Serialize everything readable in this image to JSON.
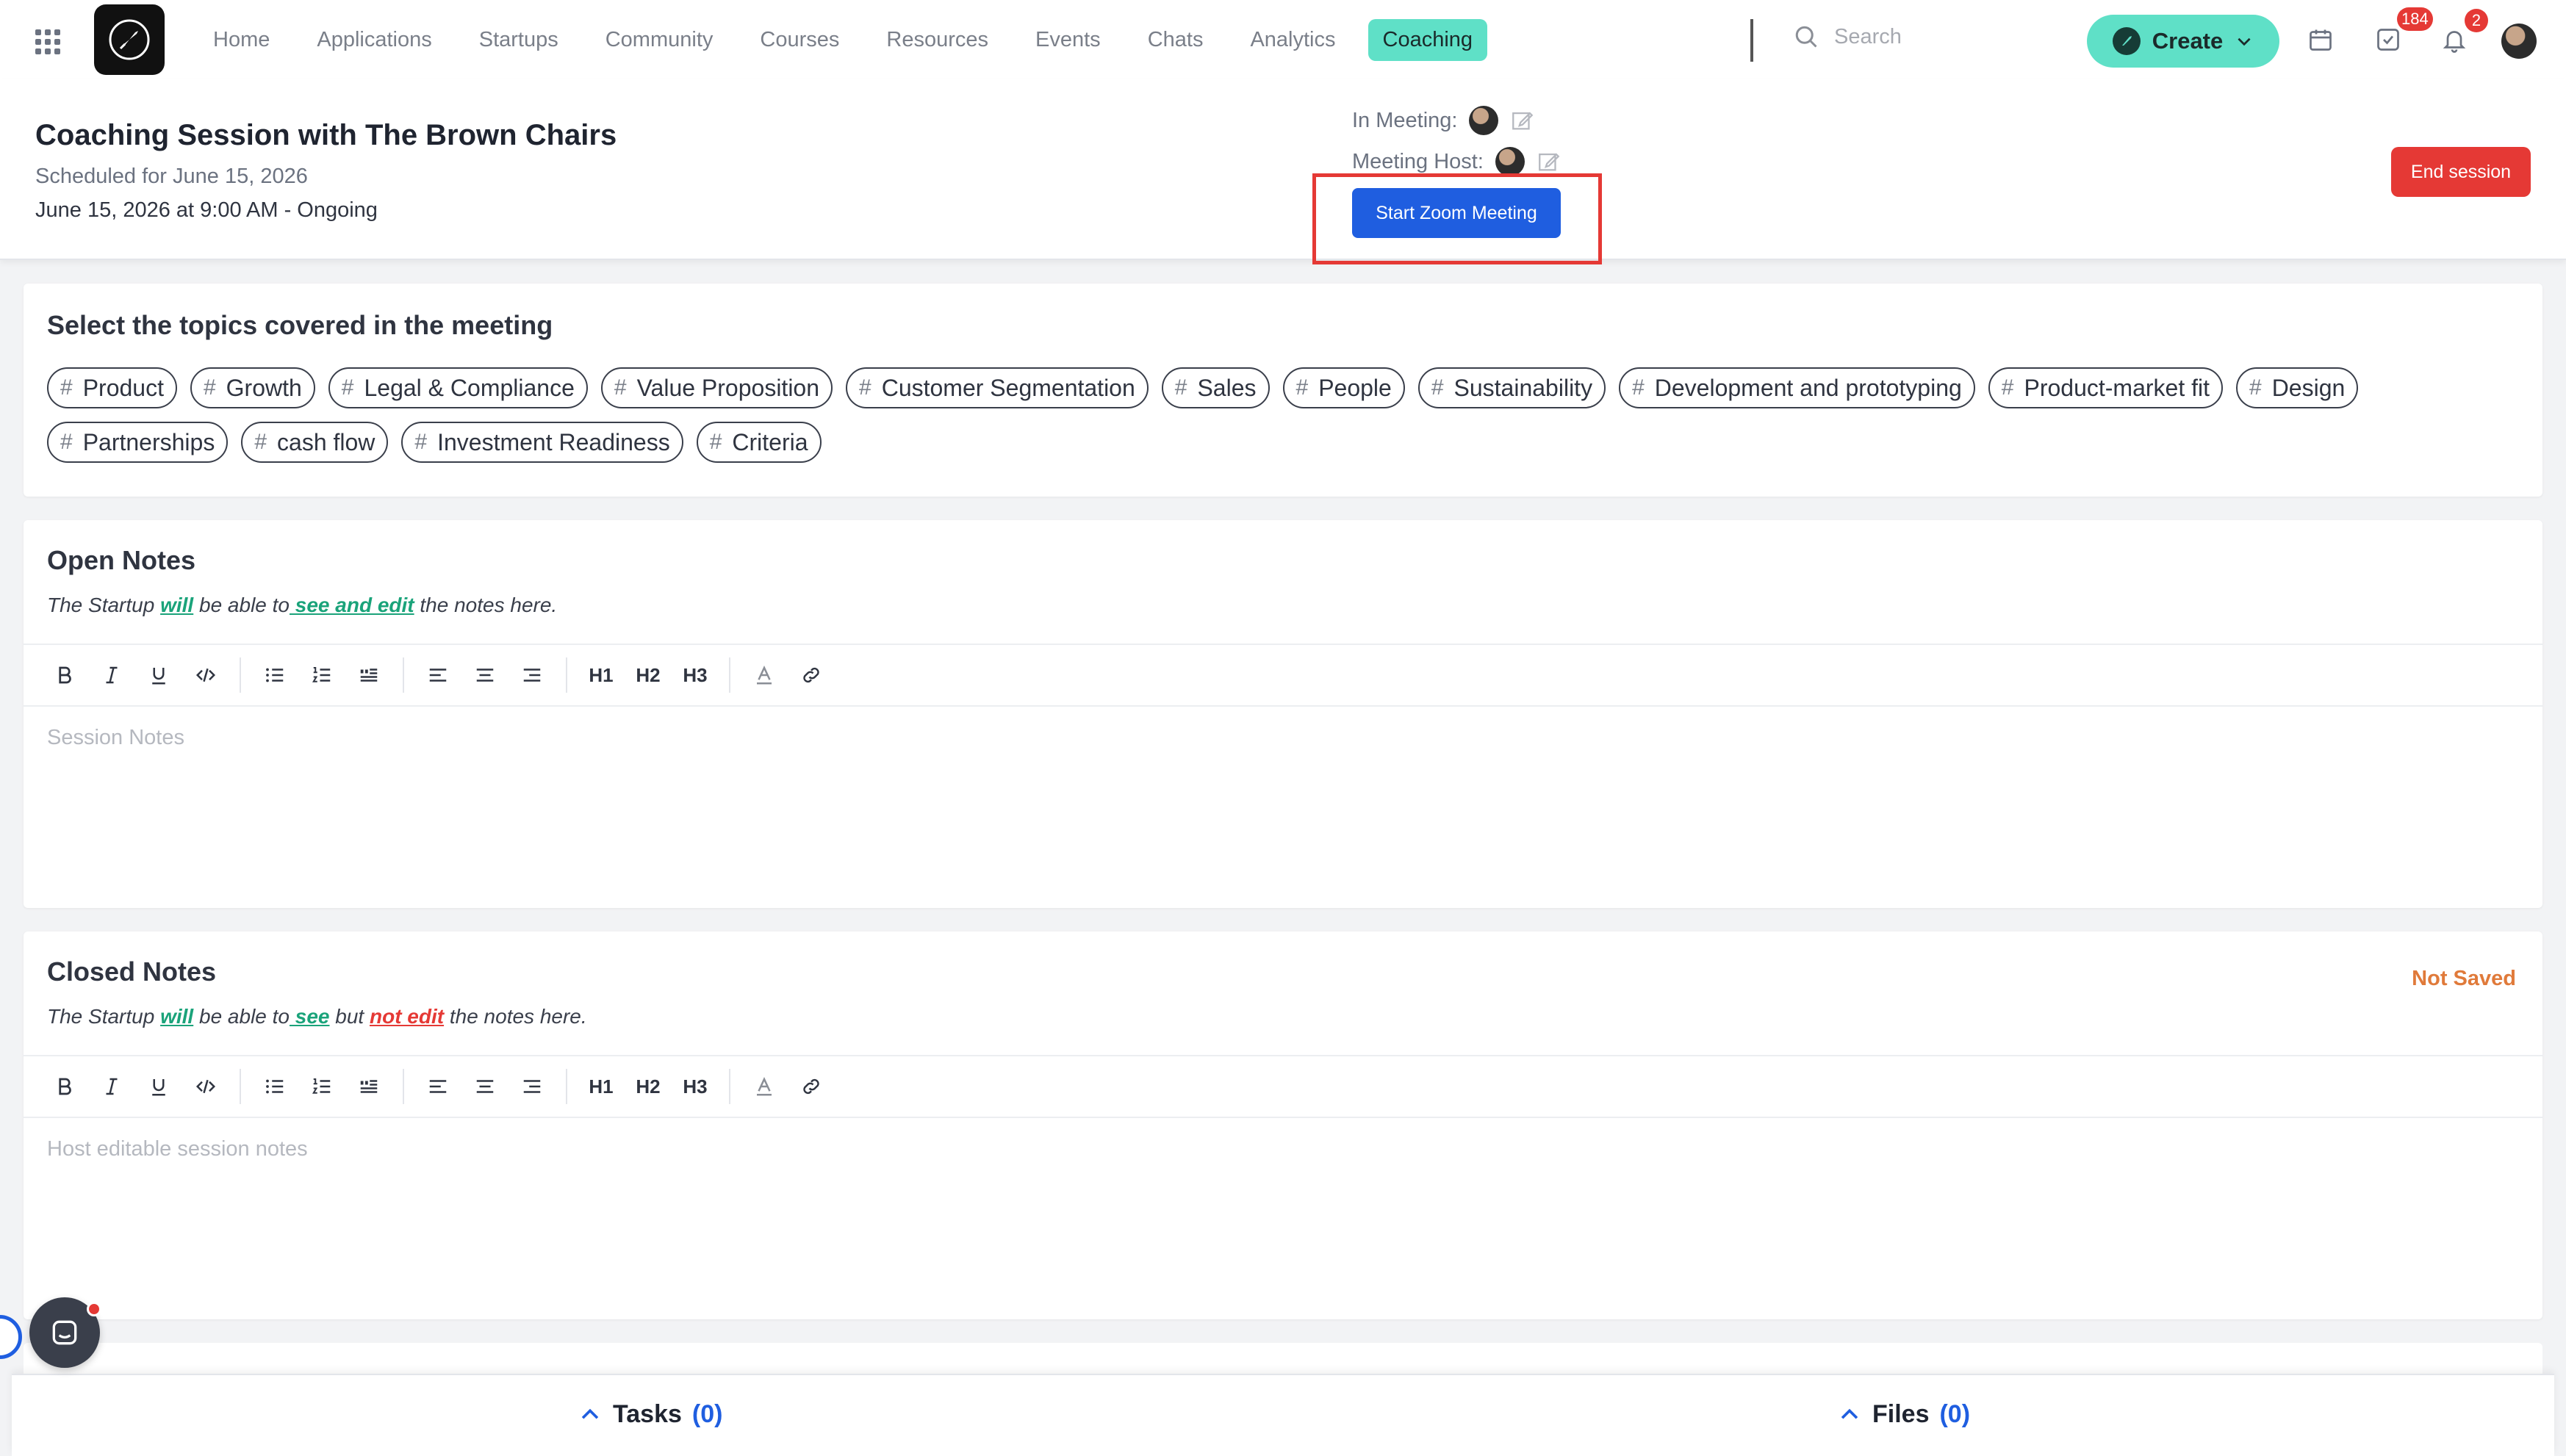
{
  "nav": {
    "items": [
      "Home",
      "Applications",
      "Startups",
      "Community",
      "Courses",
      "Resources",
      "Events",
      "Chats",
      "Analytics",
      "Coaching"
    ],
    "active": "Coaching",
    "search_placeholder": "Search",
    "create_label": "Create",
    "tasks_badge": "184",
    "notifications_badge": "2"
  },
  "session": {
    "title": "Coaching Session with The Brown Chairs",
    "scheduled": "Scheduled for June 15, 2026",
    "datetime": "June 15, 2026 at 9:00 AM - Ongoing",
    "in_meeting_label": "In Meeting:",
    "meeting_host_label": "Meeting Host:",
    "zoom_button": "Start Zoom Meeting",
    "end_button": "End session"
  },
  "topics": {
    "title": "Select the topics covered in the meeting",
    "items": [
      "Product",
      "Growth",
      "Legal & Compliance",
      "Value Proposition",
      "Customer Segmentation",
      "Sales",
      "People",
      "Sustainability",
      "Development and prototyping",
      "Product-market fit",
      "Design",
      "Partnerships",
      "cash flow",
      "Investment Readiness",
      "Criteria"
    ]
  },
  "open_notes": {
    "title": "Open Notes",
    "sub_prefix": "The Startup ",
    "sub_will": "will",
    "sub_mid": " be able to",
    "sub_action": " see and edit",
    "sub_suffix": " the notes here.",
    "placeholder": "Session Notes"
  },
  "closed_notes": {
    "title": "Closed Notes",
    "status": "Not Saved",
    "sub_prefix": "The Startup ",
    "sub_will": "will",
    "sub_mid": " be able to",
    "sub_see": " see",
    "sub_but": " but ",
    "sub_not_edit": "not edit",
    "sub_suffix": " the notes here.",
    "placeholder": "Host editable session notes"
  },
  "toolbar": {
    "h1": "H1",
    "h2": "H2",
    "h3": "H3"
  },
  "bottom": {
    "tasks_label": "Tasks",
    "tasks_count": "(0)",
    "files_label": "Files",
    "files_count": "(0)"
  },
  "colors": {
    "accent": "#5fe0c7",
    "primary_blue": "#1f5ee0",
    "danger": "#e53935",
    "warning": "#e07a3a",
    "success": "#1aa37a"
  }
}
